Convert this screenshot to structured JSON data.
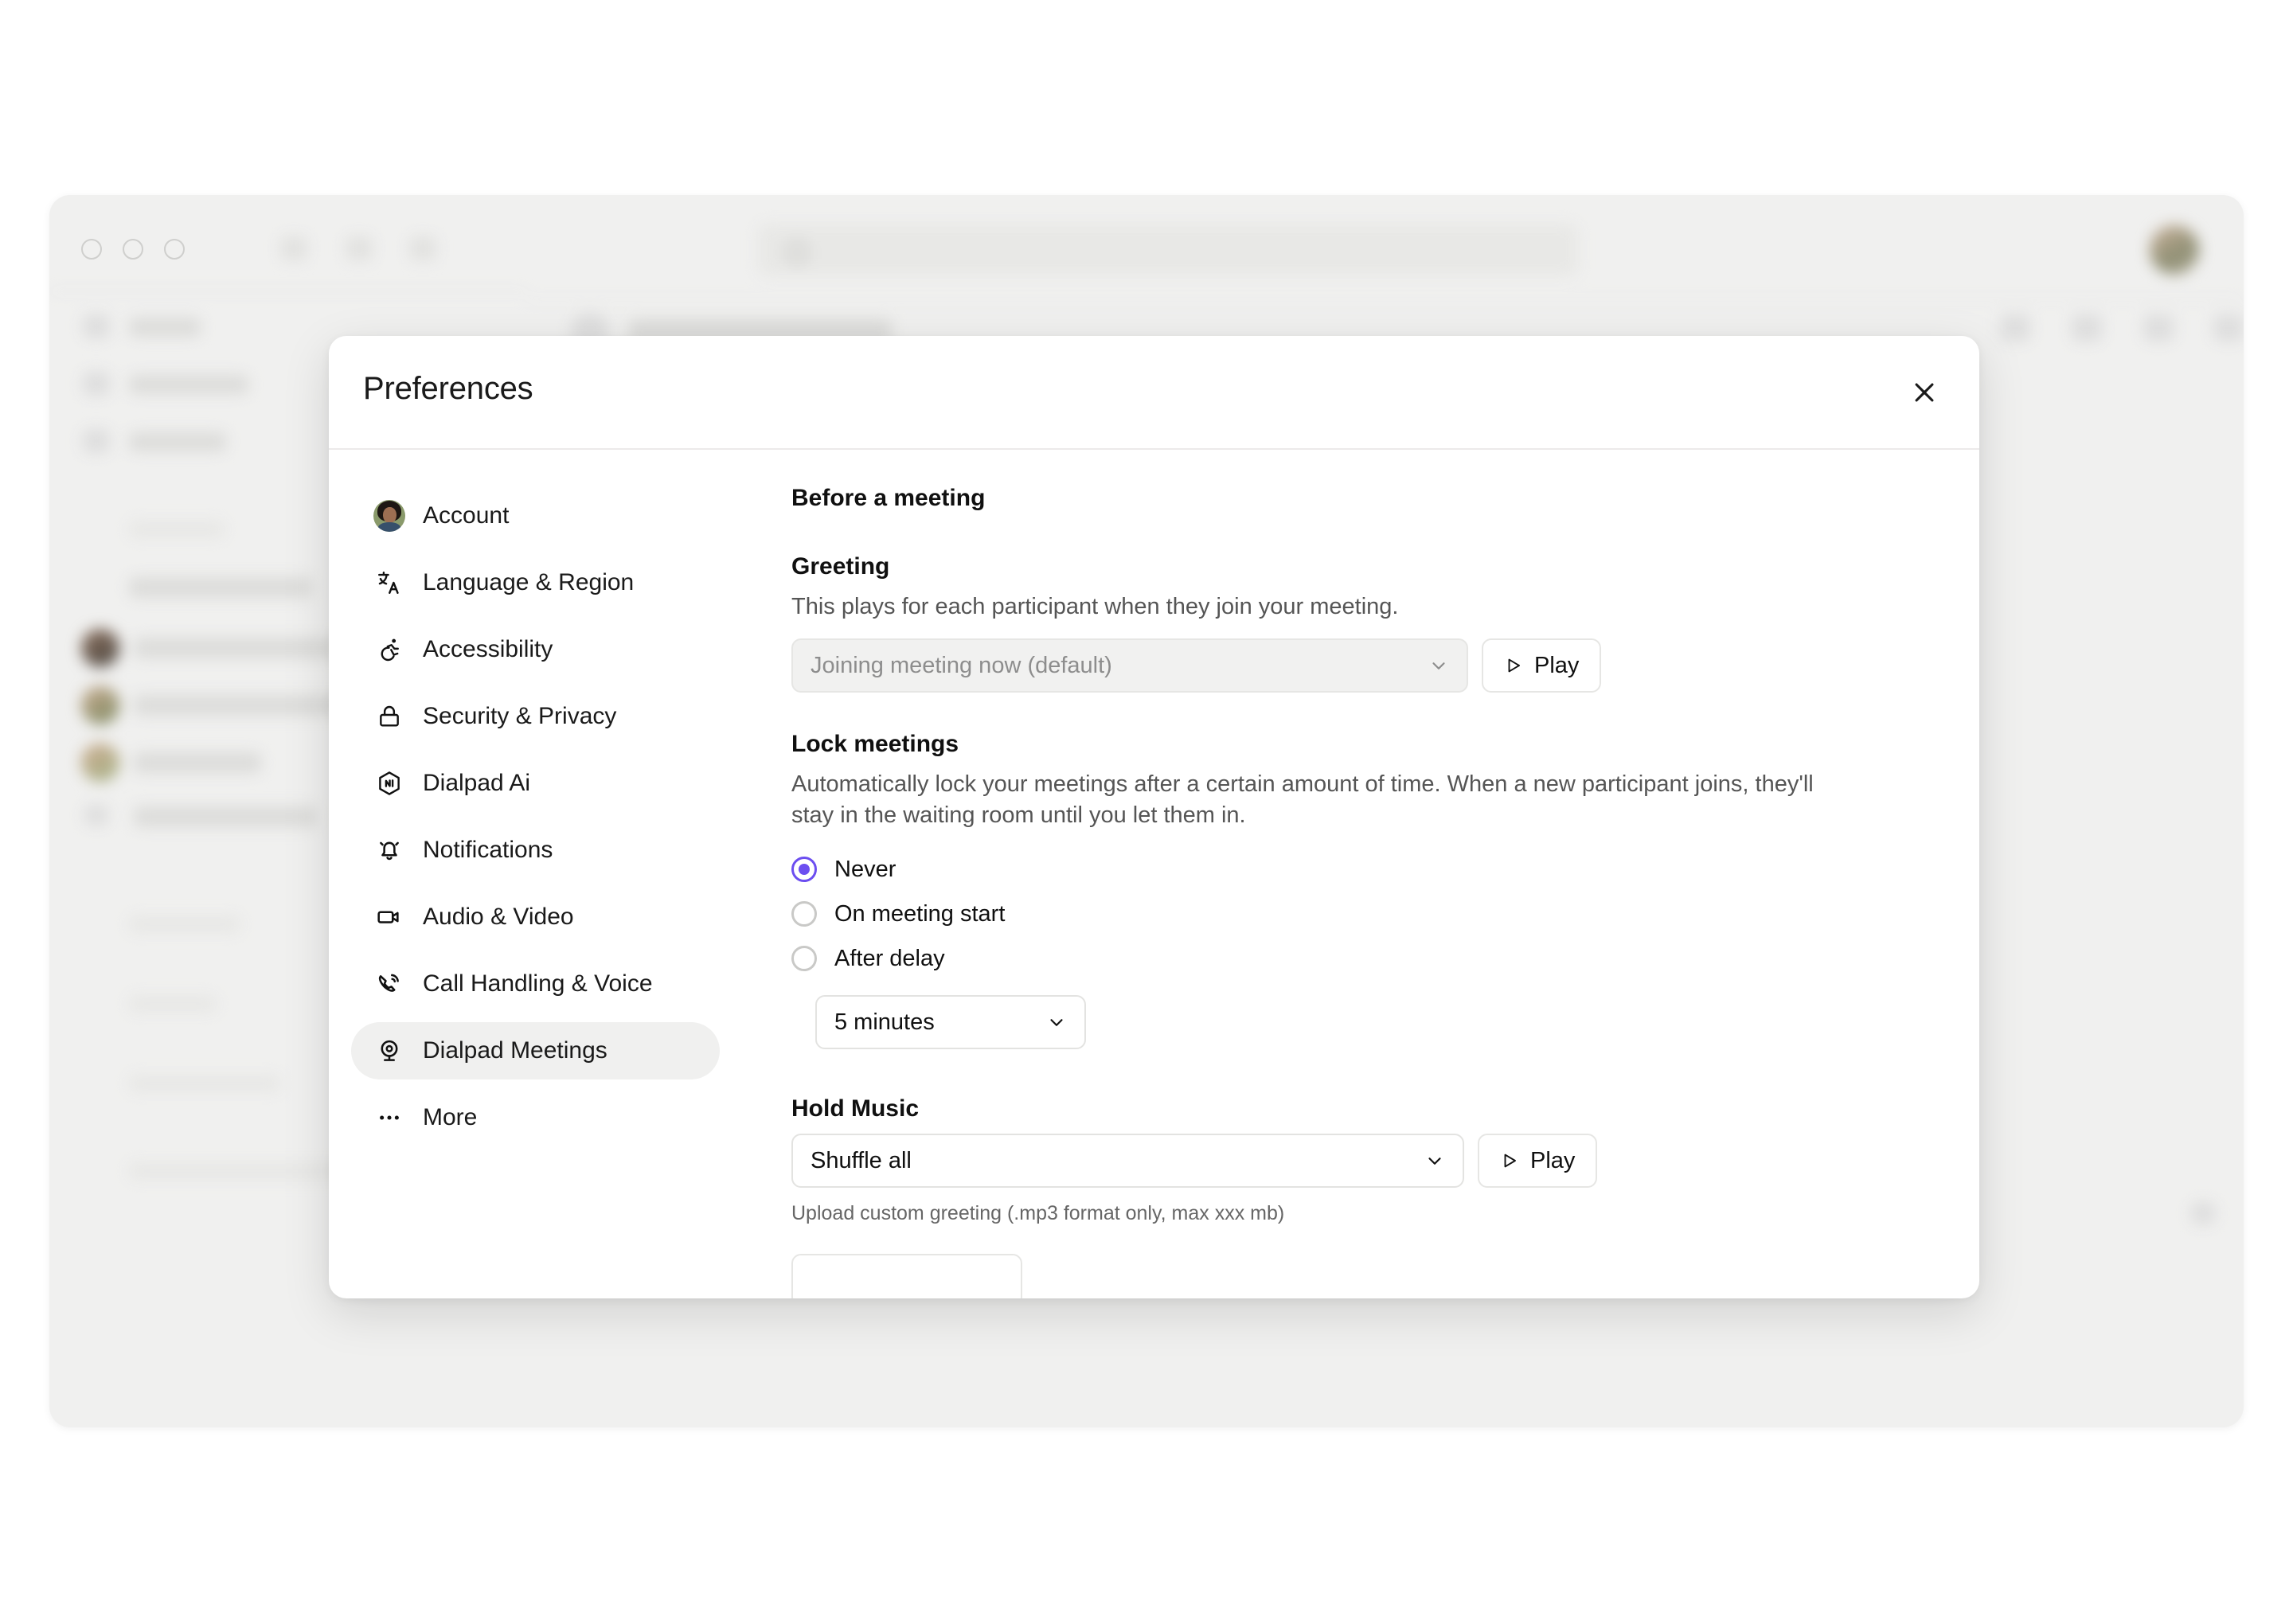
{
  "background_app": {
    "window_controls": [
      "close",
      "minimize",
      "maximize"
    ],
    "note": "blurred background application window"
  },
  "modal": {
    "title": "Preferences",
    "close_icon": "close-icon",
    "sidebar": {
      "items": [
        {
          "label": "Account",
          "icon": "user-avatar",
          "selected": false
        },
        {
          "label": "Language & Region",
          "icon": "translate-icon",
          "selected": false
        },
        {
          "label": "Accessibility",
          "icon": "accessibility-icon",
          "selected": false
        },
        {
          "label": "Security & Privacy",
          "icon": "lock-icon",
          "selected": false
        },
        {
          "label": "Dialpad Ai",
          "icon": "dialpad-ai-icon",
          "selected": false
        },
        {
          "label": "Notifications",
          "icon": "bell-icon",
          "selected": false
        },
        {
          "label": "Audio & Video",
          "icon": "video-camera-icon",
          "selected": false
        },
        {
          "label": "Call Handling & Voice",
          "icon": "phone-ring-icon",
          "selected": false
        },
        {
          "label": "Dialpad Meetings",
          "icon": "webcam-icon",
          "selected": true
        },
        {
          "label": "More",
          "icon": "ellipsis-icon",
          "selected": false
        }
      ]
    },
    "content": {
      "section_title": "Before a meeting",
      "greeting": {
        "title": "Greeting",
        "description": "This plays for each participant when they join your meeting.",
        "select_value": "Joining meeting now (default)",
        "select_disabled": true,
        "play_label": "Play"
      },
      "lock_meetings": {
        "title": "Lock meetings",
        "description": "Automatically lock your meetings after a certain amount of time. When a new participant joins, they'll stay in the waiting room until you let them in.",
        "options": [
          {
            "label": "Never",
            "selected": true
          },
          {
            "label": "On meeting start",
            "selected": false
          },
          {
            "label": "After delay",
            "selected": false
          }
        ],
        "delay_value": "5 minutes"
      },
      "hold_music": {
        "title": "Hold Music",
        "select_value": "Shuffle all",
        "play_label": "Play",
        "upload_note": "Upload custom greeting (.mp3 format only, max xxx mb)"
      }
    }
  },
  "colors": {
    "accent": "#6c4ef0",
    "selected_item_bg": "#f0f0ef",
    "modal_bg": "#ffffff",
    "app_bg": "#f0f0ef"
  }
}
